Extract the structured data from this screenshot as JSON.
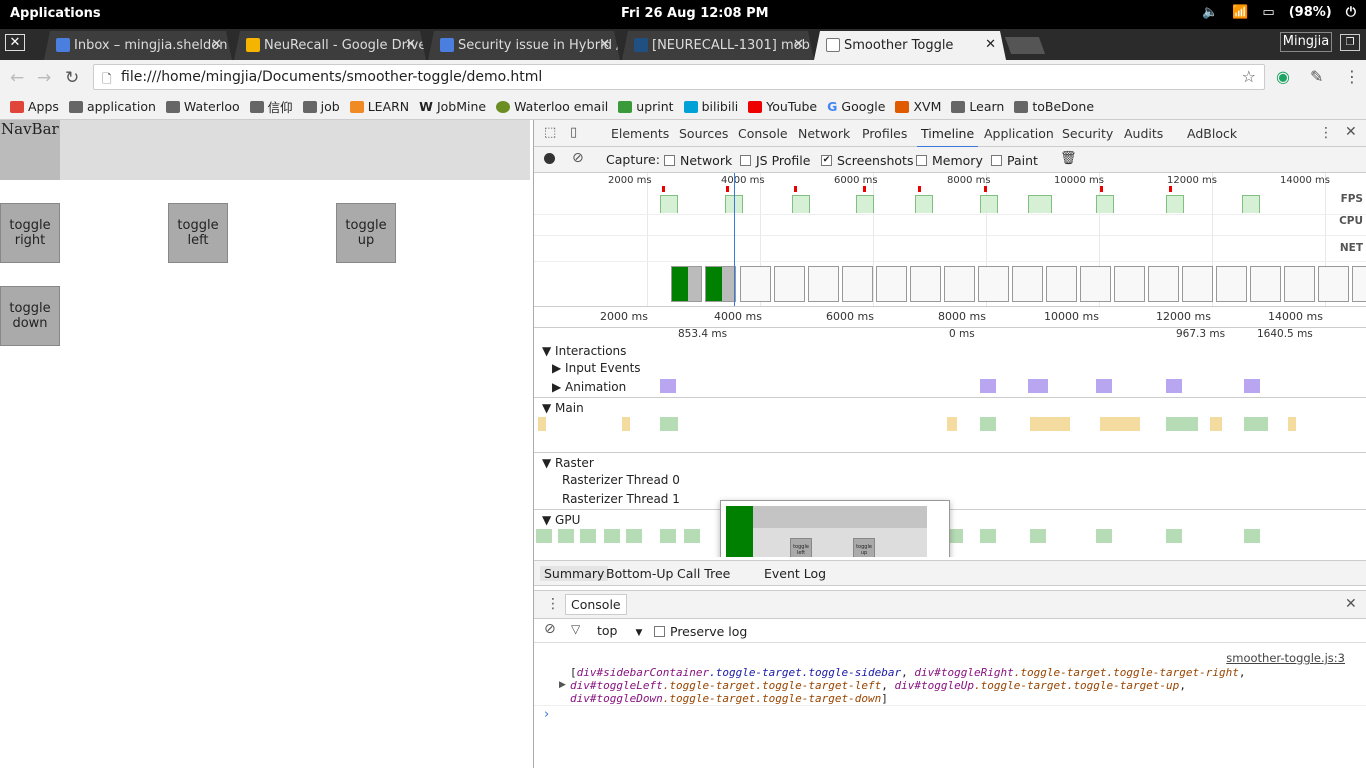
{
  "topbar": {
    "apps": "Applications",
    "datetime": "Fri 26 Aug   12:08 PM",
    "battery": "(98%)"
  },
  "tabs": [
    {
      "title": "Inbox – mingjia.sheldon",
      "color": "#4a7fe0"
    },
    {
      "title": "NeuRecall - Google Drive",
      "color": "#f4b400"
    },
    {
      "title": "Security issue in Hybrid /",
      "color": "#4a7fe0"
    },
    {
      "title": "[NEURECALL-1301] mob",
      "color": "#205081"
    },
    {
      "title": "Smoother Toggle",
      "color": "#ffffff"
    }
  ],
  "profile": "Mingjia",
  "omnibox": {
    "url": "file:///home/mingjia/Documents/smoother-toggle/demo.html"
  },
  "bookmarks": [
    {
      "label": "Apps",
      "color": "#e0453a"
    },
    {
      "label": "application",
      "color": "#666"
    },
    {
      "label": "Waterloo",
      "color": "#666"
    },
    {
      "label": "信仰",
      "color": "#666"
    },
    {
      "label": "job",
      "color": "#666"
    },
    {
      "label": "LEARN",
      "color": "#f08a24"
    },
    {
      "label": "JobMine",
      "color": "#000"
    },
    {
      "label": "Waterloo email",
      "color": "#6b8e23"
    },
    {
      "label": "uprint",
      "color": "#3a9a3a"
    },
    {
      "label": "bilibili",
      "color": "#00a1d6"
    },
    {
      "label": "YouTube",
      "color": "#e00"
    },
    {
      "label": "Google",
      "color": "#4285f4"
    },
    {
      "label": "XVM",
      "color": "#e05a00"
    },
    {
      "label": "Learn",
      "color": "#666"
    },
    {
      "label": "toBeDone",
      "color": "#666"
    }
  ],
  "page": {
    "navbar": "NavBar",
    "buttons": {
      "right": "toggle right",
      "left": "toggle left",
      "up": "toggle up",
      "down": "toggle down"
    }
  },
  "devtools": {
    "tabs": [
      "Elements",
      "Sources",
      "Console",
      "Network",
      "Profiles",
      "Timeline",
      "Application",
      "Security",
      "Audits",
      "AdBlock"
    ],
    "active_tab": "Timeline",
    "capture_label": "Capture:",
    "capture_options": [
      {
        "label": "Network",
        "checked": false
      },
      {
        "label": "JS Profile",
        "checked": false
      },
      {
        "label": "Screenshots",
        "checked": true
      },
      {
        "label": "Memory",
        "checked": false
      },
      {
        "label": "Paint",
        "checked": false
      }
    ],
    "overview_ticks": [
      "2000 ms",
      "4000 ms",
      "6000 ms",
      "8000 ms",
      "10000 ms",
      "12000 ms",
      "14000 ms"
    ],
    "flame_ticks": [
      "2000 ms",
      "4000 ms",
      "6000 ms",
      "8000 ms",
      "10000 ms",
      "12000 ms",
      "14000 ms"
    ],
    "row_labels": {
      "fps": "FPS",
      "cpu": "CPU",
      "net": "NET"
    },
    "durations": [
      "853.4 ms",
      "0 ms",
      "967.3 ms",
      "1640.5 ms"
    ],
    "sections": {
      "interactions": "Interactions",
      "input_events": "Input Events",
      "animation": "Animation",
      "main": "Main",
      "raster": "Raster",
      "raster0": "Rasterizer Thread 0",
      "raster1": "Rasterizer Thread 1",
      "gpu": "GPU"
    },
    "popup": {
      "toggle_left": "toggle left",
      "toggle_up": "toggle up"
    },
    "bottom_tabs": [
      "Summary",
      "Bottom-Up",
      "Call Tree",
      "Event Log"
    ],
    "console": {
      "title": "Console",
      "context": "top",
      "preserve_log": "Preserve log",
      "source": "smoother-toggle.js:3",
      "log": [
        {
          "el": "div#sidebarContainer",
          "cls": ".toggle-target.toggle-sidebar"
        },
        {
          "el": "div#toggleRight",
          "cls": ".toggle-target.toggle-target-right"
        },
        {
          "el": "div#toggleLeft",
          "cls": ".toggle-target.toggle-target-left"
        },
        {
          "el": "div#toggleUp",
          "cls": ".toggle-target.toggle-target-up"
        },
        {
          "el": "div#toggleDown",
          "cls": ".toggle-target.toggle-target-down"
        }
      ]
    }
  }
}
